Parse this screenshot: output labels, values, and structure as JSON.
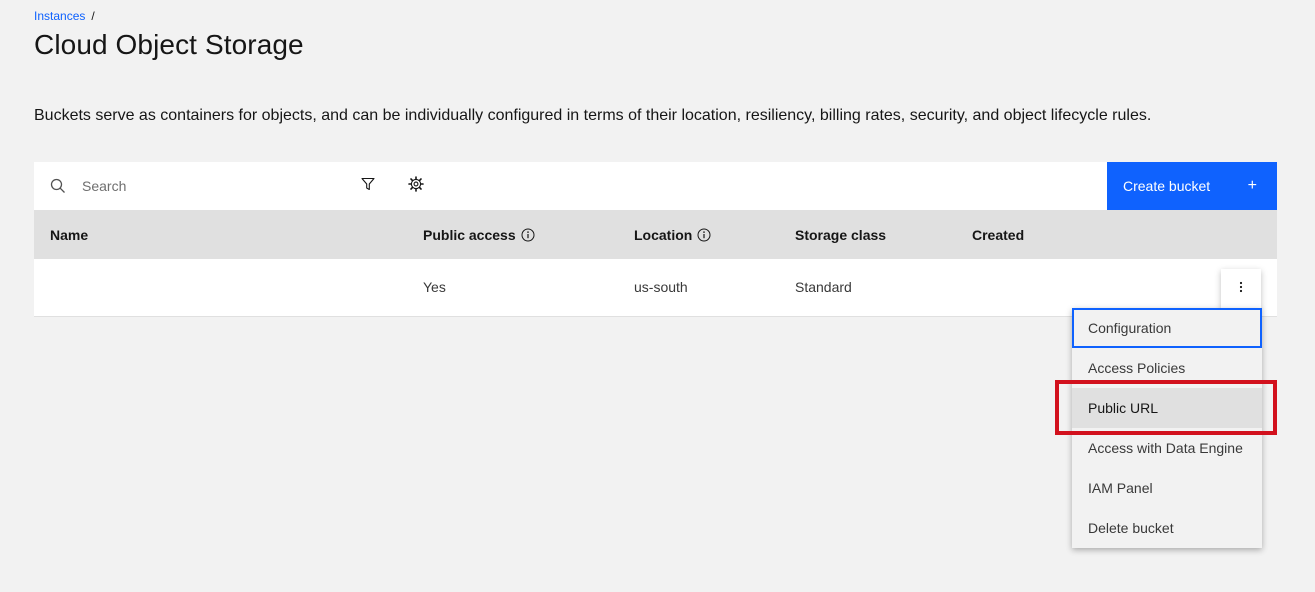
{
  "breadcrumb": {
    "items": [
      {
        "label": "Instances"
      }
    ],
    "separator": "/"
  },
  "page": {
    "title": "Cloud Object Storage",
    "description": "Buckets serve as containers for objects, and can be individually configured in terms of their location, resiliency, billing rates, security, and object lifecycle rules."
  },
  "toolbar": {
    "search_placeholder": "Search",
    "search_icon": "search-icon",
    "filter_icon": "filter-icon",
    "settings_icon": "gear-icon",
    "create_button_label": "Create bucket",
    "create_button_icon": "+",
    "accent_color": "#0f62fe"
  },
  "table": {
    "columns": [
      {
        "label": "Name"
      },
      {
        "label": "Public access",
        "info": true
      },
      {
        "label": "Location",
        "info": true
      },
      {
        "label": "Storage class"
      },
      {
        "label": "Created"
      }
    ],
    "rows": [
      {
        "name": "",
        "public_access": "Yes",
        "location": "us-south",
        "storage_class": "Standard",
        "created": ""
      }
    ]
  },
  "overflow_menu": {
    "icon": "overflow-menu-vertical-icon",
    "items": [
      {
        "label": "Configuration",
        "state": "focused"
      },
      {
        "label": "Access Policies"
      },
      {
        "label": "Public URL",
        "state": "hovered",
        "highlighted": true
      },
      {
        "label": "Access with Data Engine"
      },
      {
        "label": "IAM Panel"
      },
      {
        "label": "Delete bucket"
      }
    ],
    "highlight_color": "#d2111d"
  }
}
